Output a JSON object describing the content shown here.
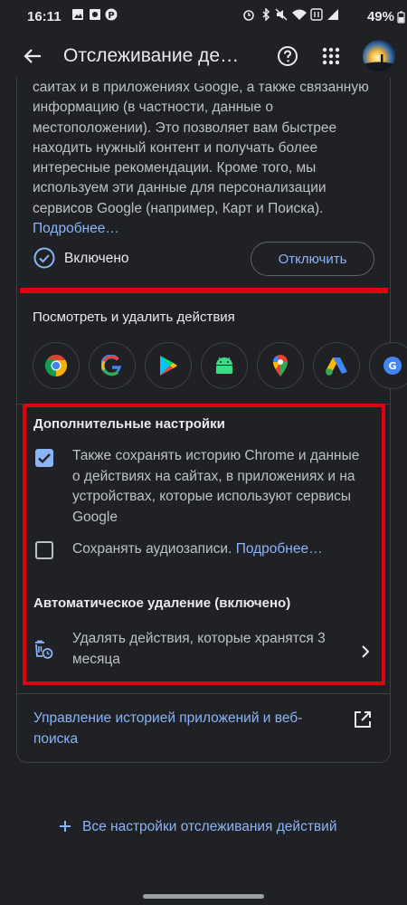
{
  "status_bar": {
    "time": "16:11",
    "battery": "49%"
  },
  "app_bar": {
    "title": "Отслеживание де…"
  },
  "intro": {
    "text": "сайтах и в приложениях Google, а также связанную информацию (в частности, данные о местоположении). Это позволяет вам быстрее находить нужный контент и получать более интересные рекомендации. Кроме того, мы используем эти данные для персонализации сервисов Google (например, Карт и Поиска).",
    "more_link": "Подробнее…"
  },
  "toggle": {
    "status_label": "Включено",
    "disable_button": "Отключить"
  },
  "activity": {
    "title": "Посмотреть и удалить действия",
    "apps": [
      "chrome-icon",
      "google-icon",
      "play-store-icon",
      "android-icon",
      "maps-icon",
      "ads-icon",
      "google-news-icon"
    ]
  },
  "advanced": {
    "title": "Дополнительные настройки",
    "chrome_history": {
      "label": "Также сохранять историю Chrome и данные о действиях на сайтах, в приложениях и на устройствах, которые используют сервисы Google",
      "checked": true
    },
    "audio": {
      "label": "Сохранять аудиозаписи.",
      "more_link": "Подробнее…",
      "checked": false
    }
  },
  "auto_delete": {
    "title": "Автоматическое удаление (включено)",
    "label": "Удалять действия, которые хранятся 3 месяца"
  },
  "manage_link": "Управление историей приложений и веб-поиска",
  "all_settings_link": "Все настройки отслеживания действий",
  "colors": {
    "accent": "#8ab4f8",
    "highlight": "#e0000e",
    "background": "#202124"
  }
}
